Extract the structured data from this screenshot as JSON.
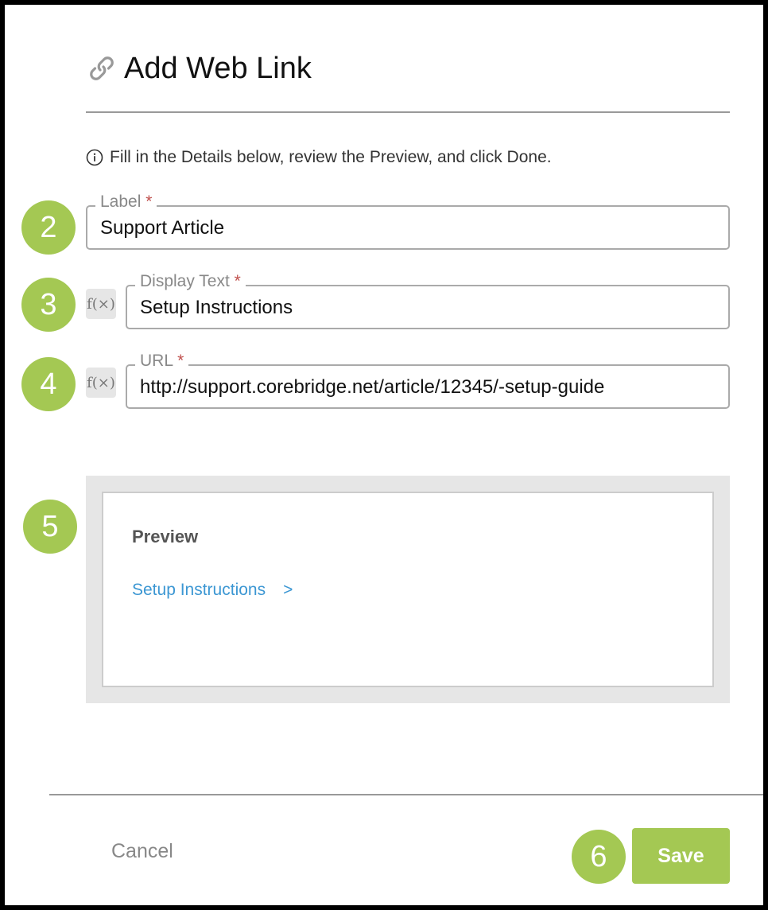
{
  "dialog": {
    "title": "Add Web Link",
    "title_icon": "link-icon",
    "info_icon": "info-icon",
    "info_text": "Fill in the Details below, review the Preview, and click Done."
  },
  "steps": [
    "2",
    "3",
    "4",
    "5",
    "6"
  ],
  "fields": {
    "label": {
      "label": "Label",
      "required_mark": "*",
      "value": "Support Article"
    },
    "display_text": {
      "label": "Display Text",
      "required_mark": "*",
      "value": "Setup Instructions",
      "fx_icon": "function-icon",
      "fx_text": "f(×)"
    },
    "url": {
      "label": "URL",
      "required_mark": "*",
      "value": "http://support.corebridge.net/article/12345/-setup-guide",
      "fx_icon": "function-icon",
      "fx_text": "f(×)"
    }
  },
  "preview": {
    "title": "Preview",
    "link_text": "Setup Instructions",
    "chevron": ">"
  },
  "footer": {
    "cancel_label": "Cancel",
    "save_label": "Save"
  },
  "colors": {
    "accent_green": "#a4c853",
    "link_blue": "#3c97d3",
    "required_red": "#c0504d"
  }
}
